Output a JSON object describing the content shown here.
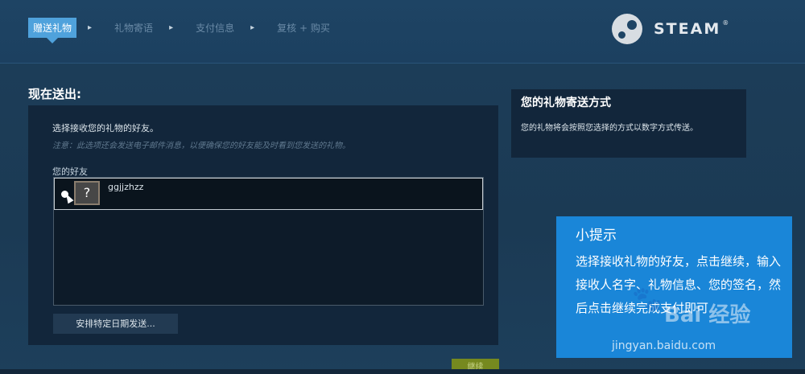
{
  "steps": {
    "step1": "赠送礼物",
    "step2": "礼物寄语",
    "step3": "支付信息",
    "step4": "复核 + 购买",
    "separator": "▸"
  },
  "logo": {
    "text": "STEAM",
    "tm": "®"
  },
  "main": {
    "title": "现在送出:",
    "description": "选择接收您的礼物的好友。",
    "note": "注意：此选项还会发送电子邮件消息，以便确保您的好友能及时看到您发送的礼物。",
    "friends_label": "您的好友",
    "friend": {
      "name": "ggjjzhzz",
      "avatar_glyph": "?"
    },
    "schedule_button": "安排特定日期发送..."
  },
  "side": {
    "title": "您的礼物寄送方式",
    "text": "您的礼物将会按照您选择的方式以数字方式传送。"
  },
  "tip": {
    "title": "小提示",
    "body": "选择接收礼物的好友，点击继续，输入接收人名字、礼物信息、您的签名，然后点击继续完成支付即可"
  },
  "watermark": {
    "text": "Bai 经验",
    "url": "jingyan.baidu.com"
  },
  "continue_button": "继续"
}
